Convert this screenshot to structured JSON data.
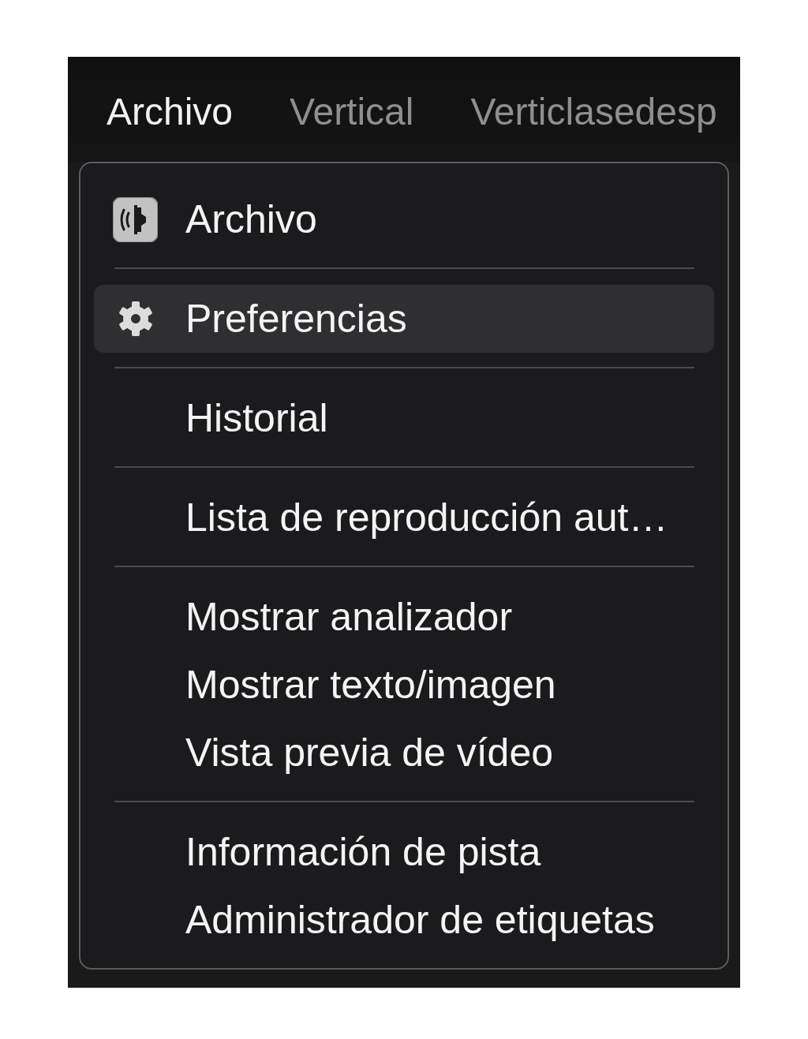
{
  "menu_bar": {
    "tabs": [
      {
        "label": "Archivo",
        "selected": true
      },
      {
        "label": "Vertical",
        "selected": false
      },
      {
        "label": "Verticlasedesp",
        "selected": false
      }
    ]
  },
  "dropdown": {
    "groups": [
      {
        "items": [
          {
            "label": "Archivo",
            "kind": "header",
            "selected": false
          }
        ]
      },
      {
        "items": [
          {
            "label": "Preferencias",
            "kind": "settings",
            "selected": true
          }
        ]
      },
      {
        "items": [
          {
            "label": "Historial",
            "kind": "plain",
            "selected": false
          }
        ]
      },
      {
        "items": [
          {
            "label": "Lista de reproducción aut…",
            "kind": "plain",
            "selected": false
          }
        ]
      },
      {
        "items": [
          {
            "label": "Mostrar analizador",
            "kind": "plain",
            "selected": false
          },
          {
            "label": "Mostrar texto/imagen",
            "kind": "plain",
            "selected": false
          },
          {
            "label": "Vista previa de vídeo",
            "kind": "plain",
            "selected": false
          }
        ]
      },
      {
        "items": [
          {
            "label": "Información de pista",
            "kind": "plain",
            "selected": false
          },
          {
            "label": "Administrador de etiquetas",
            "kind": "plain",
            "selected": false
          }
        ]
      }
    ]
  }
}
